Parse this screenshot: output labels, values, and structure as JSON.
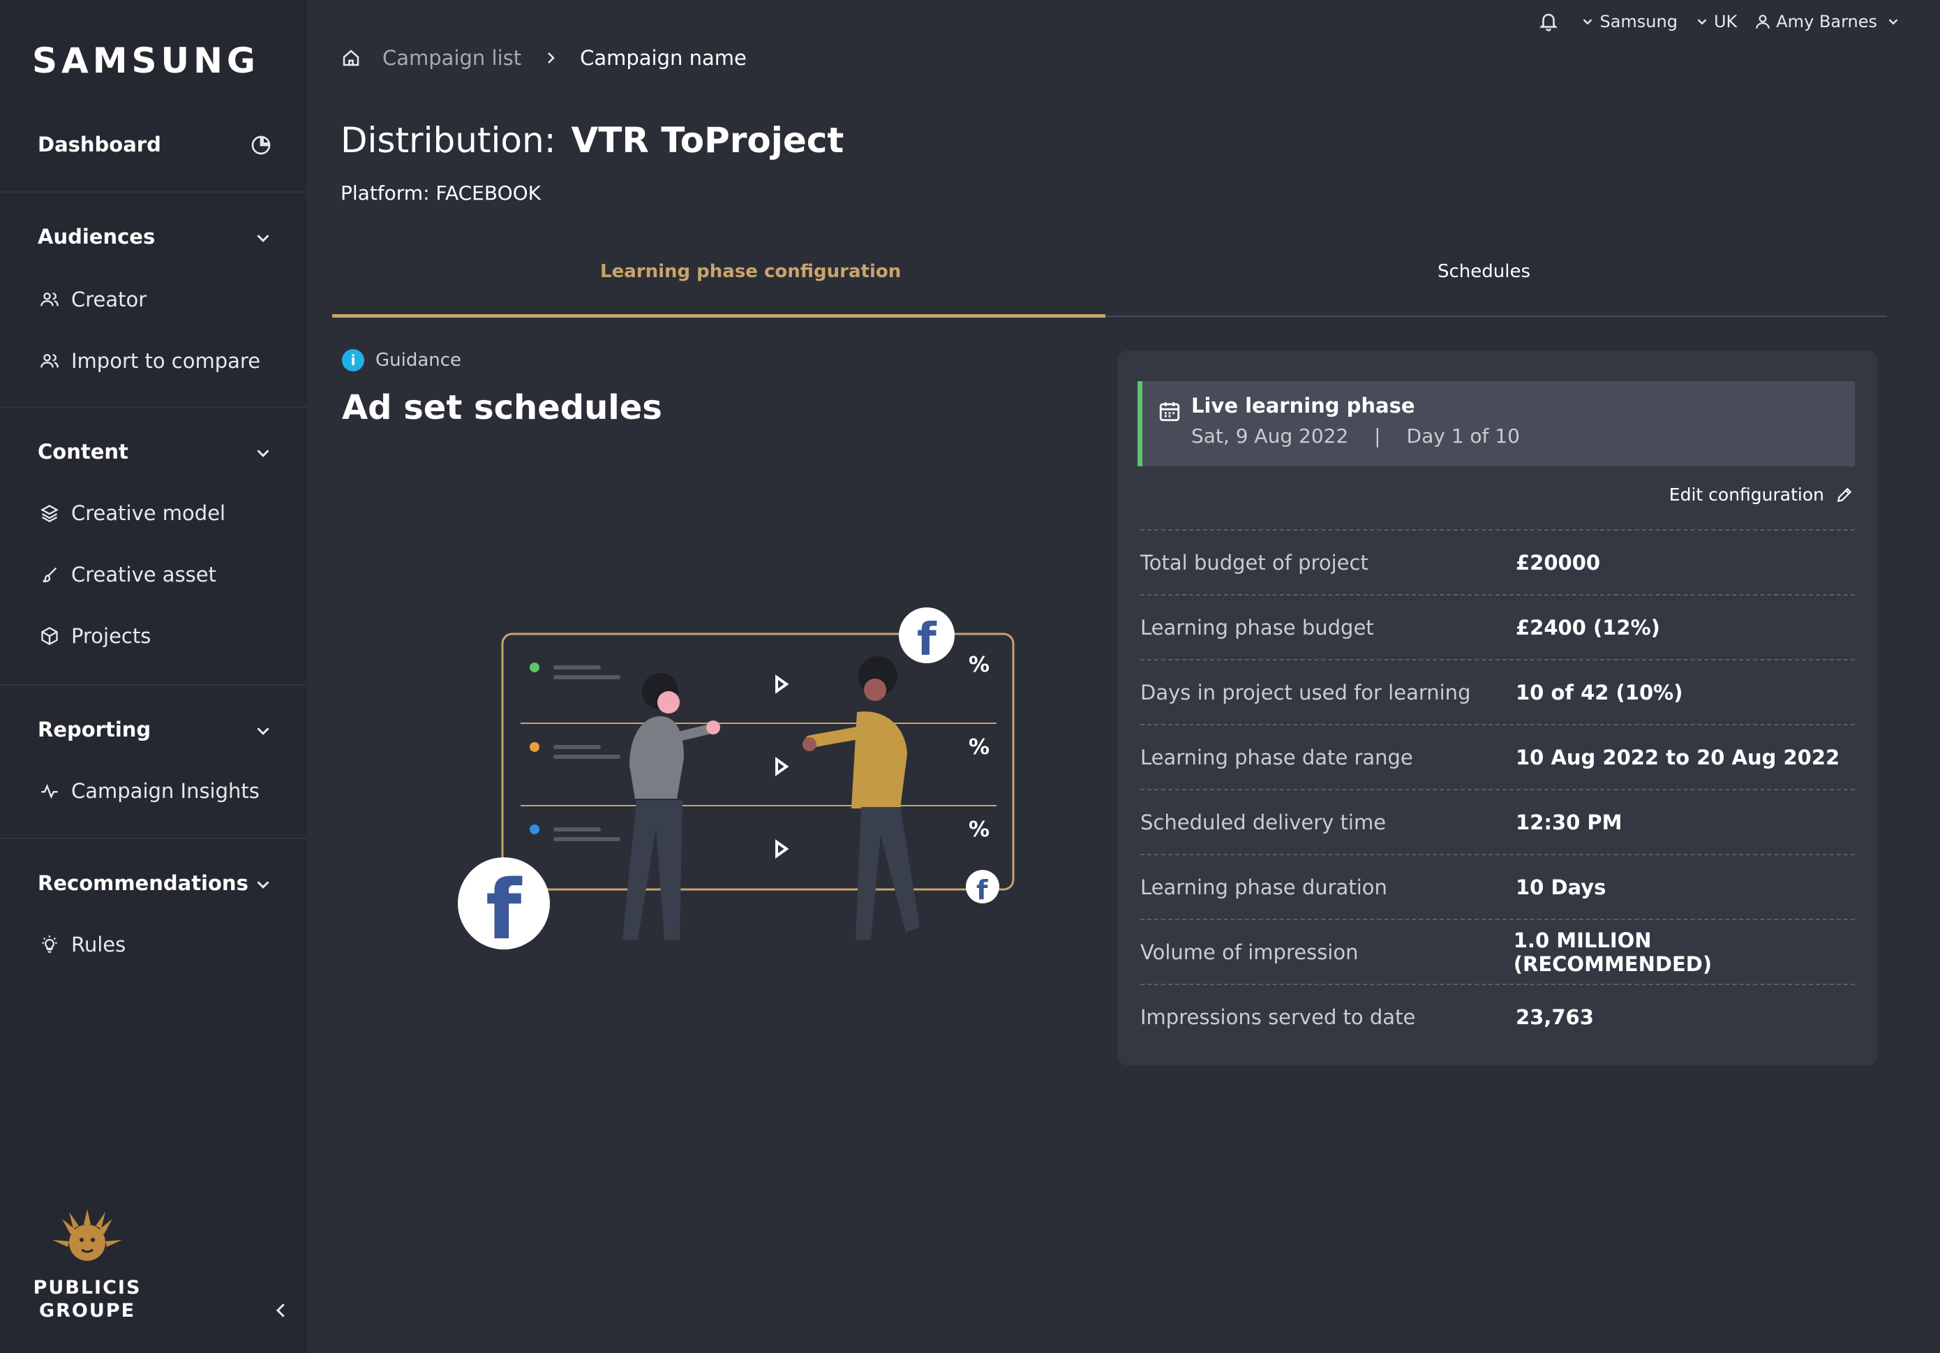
{
  "brand": "SAMSUNG",
  "topbar": {
    "org": "Samsung",
    "region": "UK",
    "user": "Amy Barnes"
  },
  "sidebar": {
    "dashboard": "Dashboard",
    "audiences": {
      "title": "Audiences",
      "items": [
        "Creator",
        "Import to compare"
      ]
    },
    "content": {
      "title": "Content",
      "items": [
        "Creative model",
        "Creative asset",
        "Projects"
      ]
    },
    "reporting": {
      "title": "Reporting",
      "items": [
        "Campaign Insights"
      ]
    },
    "recommendations": {
      "title": "Recommendations",
      "items": [
        "Rules"
      ]
    },
    "footer_logo": [
      "PUBLICIS",
      "GROUPE"
    ]
  },
  "breadcrumb": {
    "parent": "Campaign list",
    "current": "Campaign name"
  },
  "page": {
    "title_prefix": "Distribution:",
    "title_name": "VTR ToProject",
    "platform": "Platform: FACEBOOK"
  },
  "tabs": {
    "active": "Learning phase configuration",
    "other": "Schedules"
  },
  "guidance": {
    "label": "Guidance",
    "heading": "Ad set schedules"
  },
  "panel": {
    "live_title": "Live learning phase",
    "live_date": "Sat, 9 Aug 2022",
    "live_sep": "|",
    "live_day": "Day 1 of 10",
    "edit": "Edit configuration",
    "rows": [
      {
        "k": "Total budget of project",
        "v": "£20000"
      },
      {
        "k": "Learning phase budget",
        "v": "£2400 (12%)"
      },
      {
        "k": "Days in project used for learning",
        "v": "10 of 42 (10%)"
      },
      {
        "k": "Learning phase date range",
        "v": "10 Aug 2022 to 20 Aug 2022"
      },
      {
        "k": "Scheduled delivery time",
        "v": "12:30 PM"
      },
      {
        "k": "Learning phase duration",
        "v": "10 Days"
      },
      {
        "k": "Volume of impression",
        "v": "1.0 MILLION (RECOMMENDED)"
      },
      {
        "k": "Impressions served to date",
        "v": "23,763"
      }
    ]
  },
  "colors": {
    "accent": "#c9a46a",
    "live": "#5ec46a",
    "info": "#1fb0e6",
    "facebook": "#3b5998"
  }
}
